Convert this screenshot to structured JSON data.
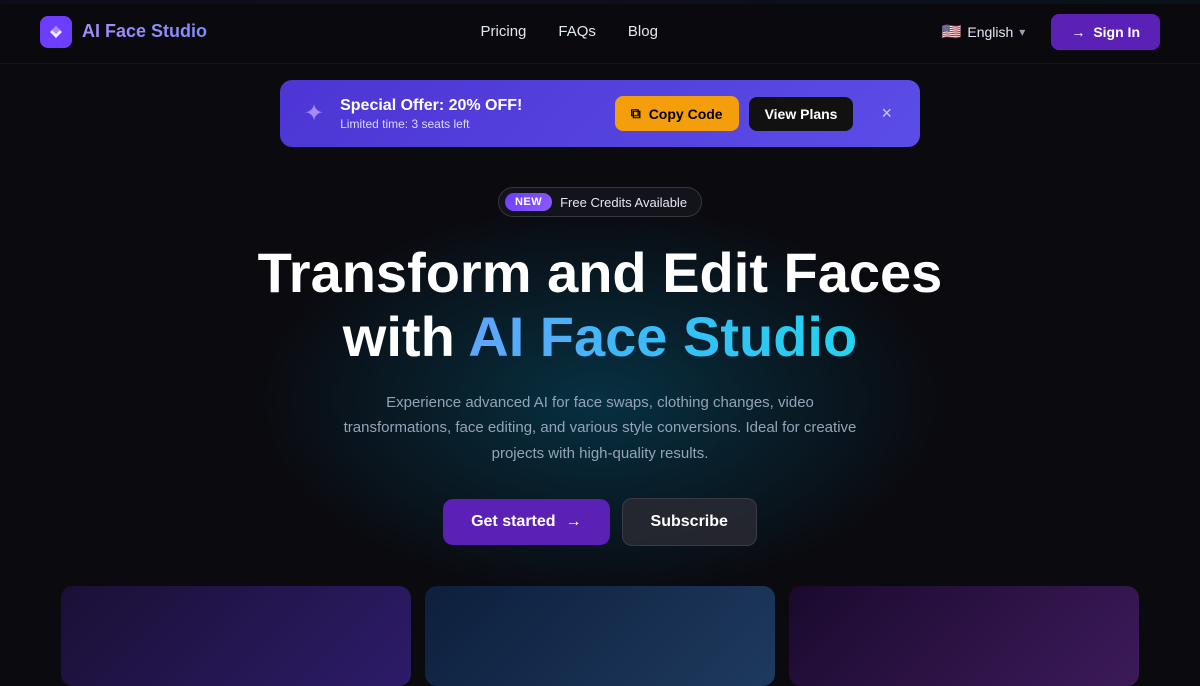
{
  "header": {
    "logo_text": "AI Face Studio",
    "nav": {
      "pricing": "Pricing",
      "faqs": "FAQs",
      "blog": "Blog"
    },
    "language": {
      "flag": "🇺🇸",
      "label": "English"
    },
    "sign_in": "Sign In"
  },
  "banner": {
    "title": "Special Offer: 20% OFF!",
    "subtitle": "Limited time: 3 seats left",
    "copy_code_label": "Copy Code",
    "view_plans_label": "View Plans",
    "close_label": "×"
  },
  "hero": {
    "badge_new": "New",
    "badge_text": "Free Credits Available",
    "title_line1": "Transform and Edit Faces",
    "title_line2_plain": "with ",
    "title_line2_gradient": "AI Face Studio",
    "subtitle": "Experience advanced AI for face swaps, clothing changes, video transformations, face editing, and various style conversions. Ideal for creative projects with high-quality results.",
    "get_started": "Get started",
    "subscribe": "Subscribe",
    "arrow": "→"
  }
}
